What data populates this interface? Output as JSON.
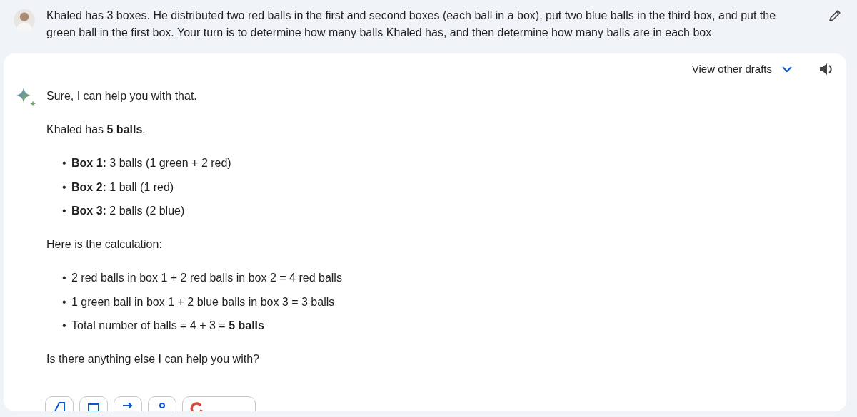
{
  "prompt": {
    "text": "Khaled has 3 boxes. He distributed two red balls in the first and second boxes (each ball in a box), put two blue balls in the third box, and put the green ball in the first box. Your turn is to determine how many balls Khaled has, and then determine how many balls are in each box"
  },
  "response": {
    "drafts_label": "View other drafts",
    "blocks": [
      {
        "kind": "paragraph",
        "text": "Sure, I can help you with that."
      },
      {
        "kind": "paragraph",
        "text": "Khaled has **5 balls**."
      },
      {
        "kind": "list",
        "items": [
          {
            "bullet": "•",
            "text": "**Box 1:** 3 balls (1 green + 2 red)"
          },
          {
            "bullet": "•",
            "text": "**Box 2:** 1 ball (1 red)"
          },
          {
            "bullet": "•",
            "text": "**Box 3:** 2 balls (2 blue)"
          }
        ]
      },
      {
        "kind": "paragraph",
        "text": "Here is the calculation:"
      },
      {
        "kind": "list",
        "items": [
          {
            "bullet": "•",
            "text": "2 red balls in box 1 + 2 red balls in box 2 = 4 red balls"
          },
          {
            "bullet": "•",
            "text": "1 green ball in box 1 + 2 blue balls in box 3 = 3 balls"
          },
          {
            "bullet": "•",
            "text": "Total number of balls = 4 + 3 = **5 balls**"
          }
        ]
      },
      {
        "kind": "paragraph",
        "text": "Is there anything else I can help you with?"
      }
    ]
  }
}
